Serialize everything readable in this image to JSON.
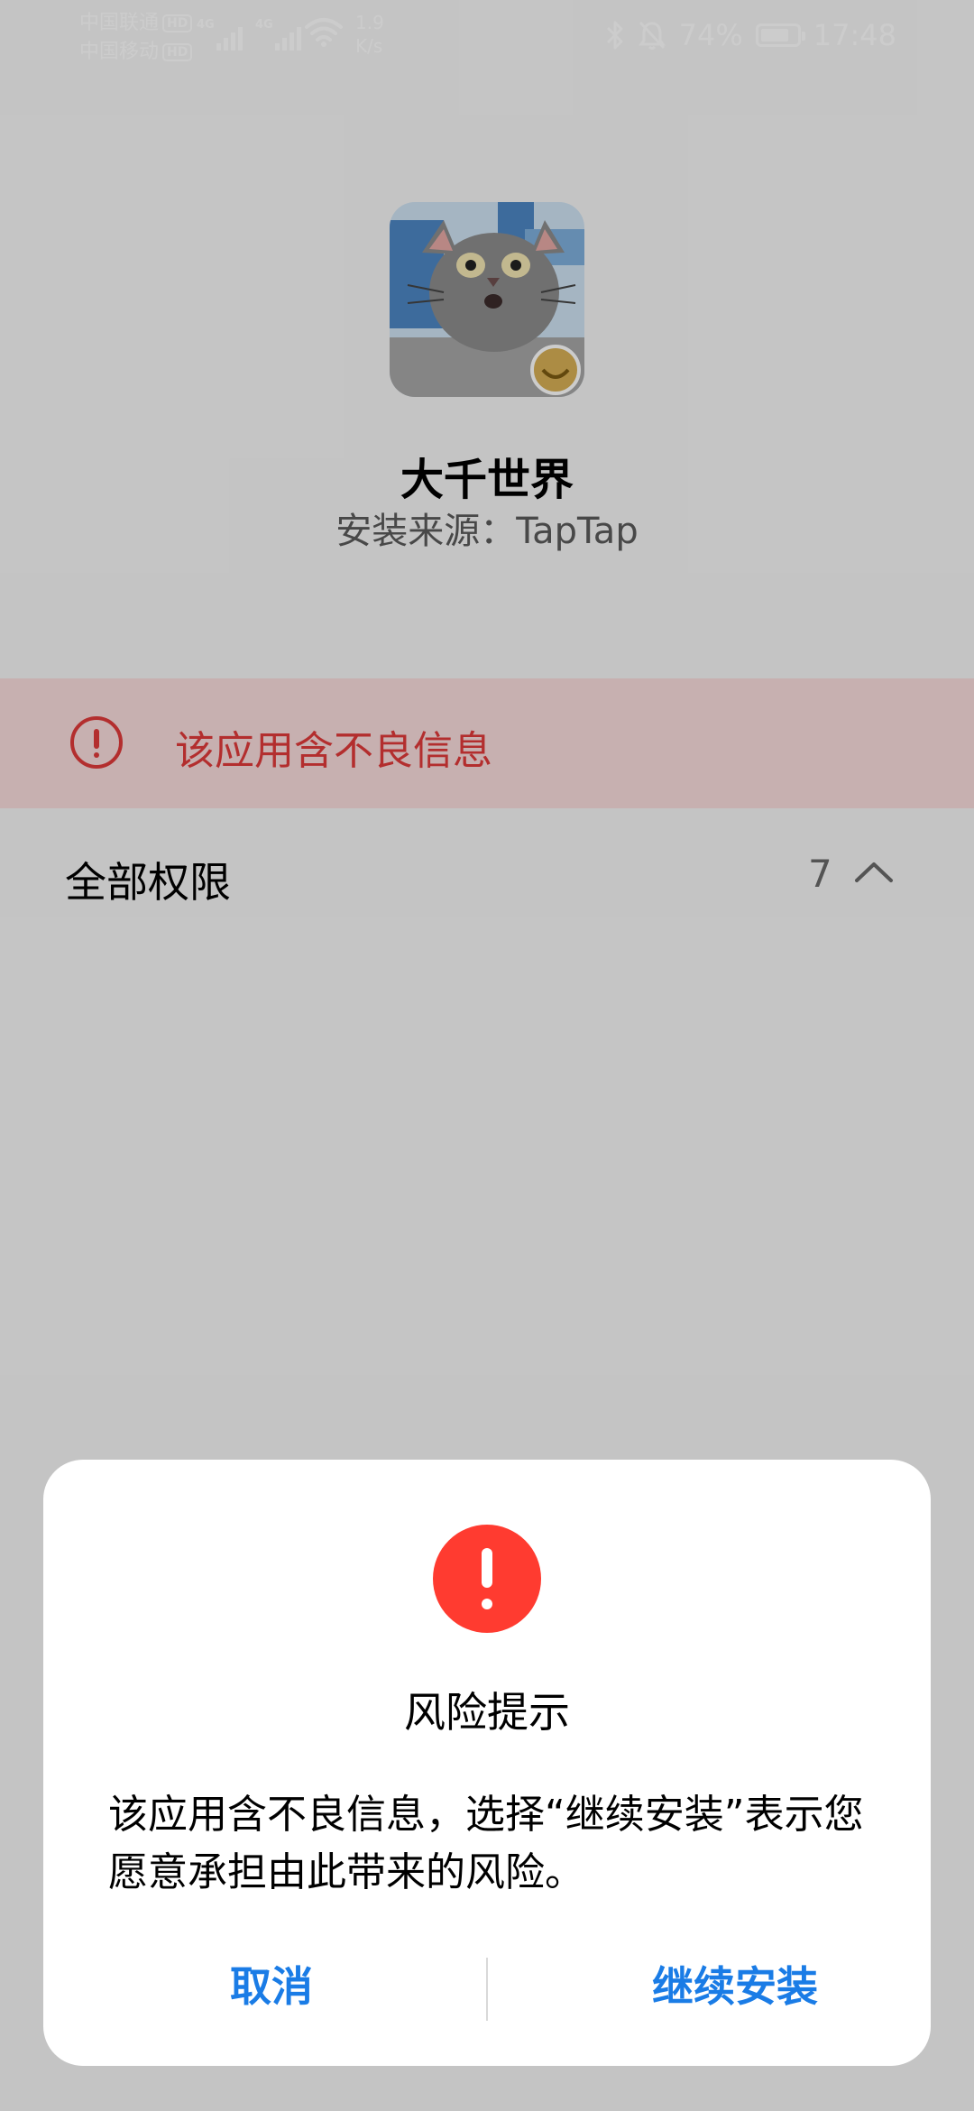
{
  "status_bar": {
    "carrier_1": "中国联通",
    "carrier_2": "中国移动",
    "hd_badge": "HD",
    "network_1": "4G",
    "network_2": "4G",
    "speed_value": "1.9",
    "speed_unit": "K/s",
    "battery_percent": "74%",
    "battery_level": 0.74,
    "time": "17:48",
    "icons": [
      "signal-icon",
      "wifi-icon",
      "bluetooth-icon",
      "mute-bell-icon",
      "battery-icon"
    ]
  },
  "app": {
    "name": "大千世界",
    "source": "安装来源：TapTap",
    "icon": "pixel-cat-app-icon"
  },
  "warning": {
    "text": "该应用含不良信息",
    "color": "#e03a3a"
  },
  "permissions": {
    "label": "全部权限",
    "count": "7"
  },
  "dialog": {
    "title": "风险提示",
    "message": "该应用含不良信息，选择“继续安装”表示您愿意承担由此带来的风险。",
    "cancel_label": "取消",
    "continue_label": "继续安装",
    "accent_color": "#1a7ce6",
    "alert_color": "#ff3b30"
  }
}
